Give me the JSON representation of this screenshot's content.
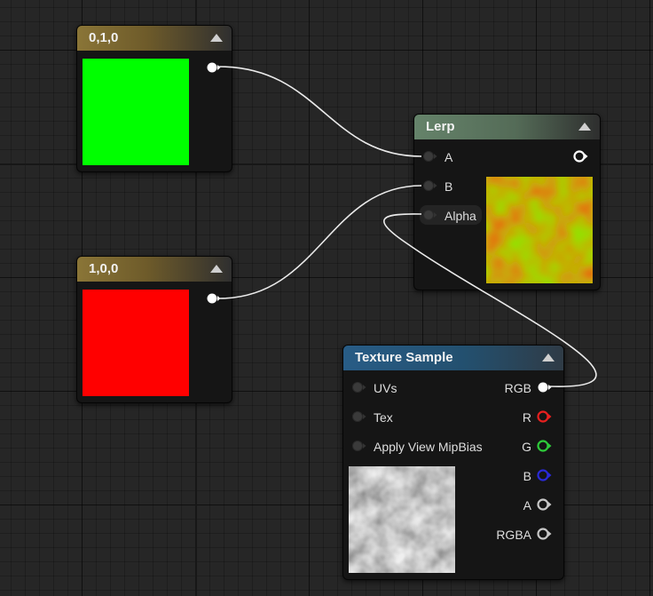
{
  "nodes": {
    "const_green": {
      "title": "0,1,0",
      "output_color": "#ffffff",
      "swatch_color": "#00ff00"
    },
    "const_red": {
      "title": "1,0,0",
      "output_color": "#ffffff",
      "swatch_color": "#ff0000"
    },
    "lerp": {
      "title": "Lerp",
      "inputs": [
        "A",
        "B",
        "Alpha"
      ],
      "output": ""
    },
    "texture_sample": {
      "title": "Texture Sample",
      "inputs": [
        "UVs",
        "Tex",
        "Apply View MipBias"
      ],
      "outputs": [
        {
          "label": "RGB",
          "color": "#ffffff"
        },
        {
          "label": "R",
          "color": "#e8201f"
        },
        {
          "label": "G",
          "color": "#2ecb3a"
        },
        {
          "label": "B",
          "color": "#2a2ad8"
        },
        {
          "label": "A",
          "color": "#c8c8c8"
        },
        {
          "label": "RGBA",
          "color": "#c8c8c8"
        }
      ]
    }
  },
  "icons": {
    "collapse": "triangle-up-icon",
    "pin": "exec-pin-icon"
  }
}
